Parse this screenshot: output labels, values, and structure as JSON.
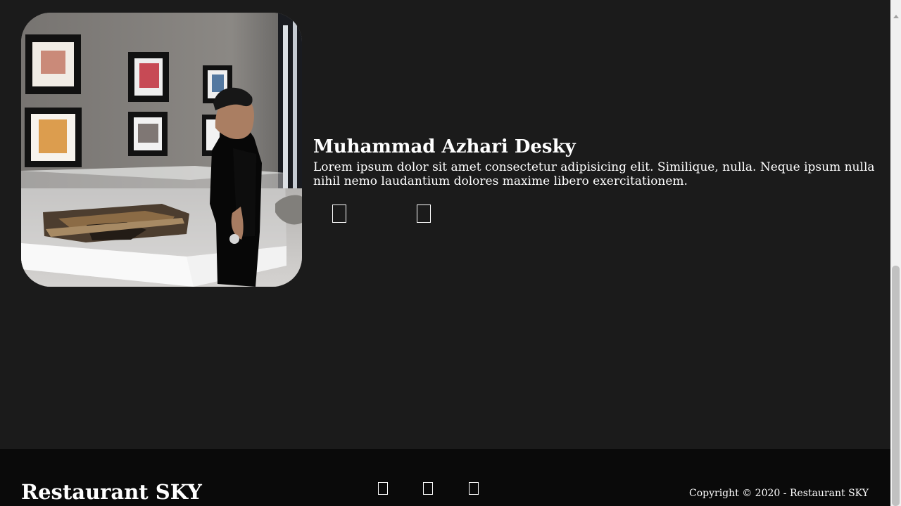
{
  "profile": {
    "photo_alt": "Person standing beside a typewriter display case in a gallery",
    "name": "Muhammad Azhari Desky",
    "bio": "Lorem ipsum dolor sit amet consectetur adipisicing elit. Similique, nulla. Neque ipsum nulla nihil nemo laudantium dolores maxime libero exercitationem.",
    "social_icons": [
      "social-icon",
      "social-icon"
    ]
  },
  "footer": {
    "brand": "Restaurant SKY",
    "social_icons": [
      "social-icon",
      "social-icon",
      "social-icon"
    ],
    "copyright": "Copyright © 2020 - Restaurant SKY"
  },
  "colors": {
    "page_background": "#1b1b1b",
    "footer_background": "#0a0a0a",
    "text": "#ffffff"
  }
}
